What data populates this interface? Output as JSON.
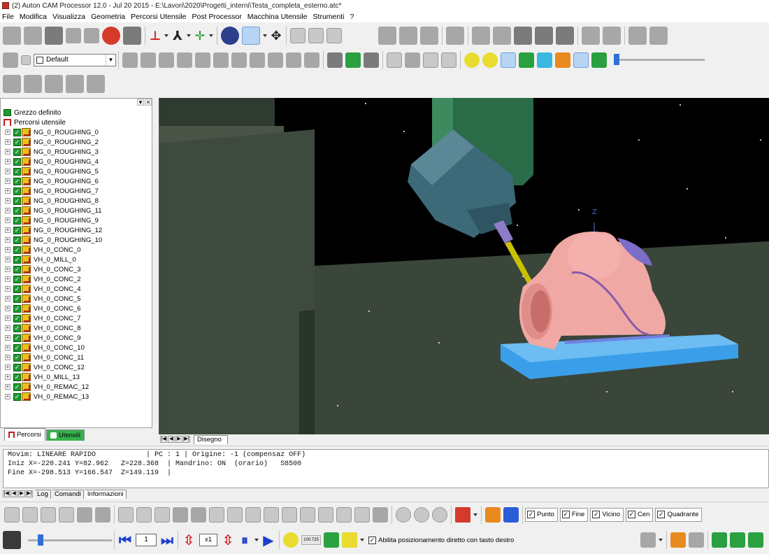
{
  "window": {
    "title": "(2) Auton CAM Processor 12.0  -  Jul 20 2015 - E:\\Lavori\\2020\\Progetti_interni\\Testa_completa_esterno.atc*"
  },
  "menu": [
    "File",
    "Modifica",
    "Visualizza",
    "Geometria",
    "Percorsi Utensile",
    "Post Processor",
    "Macchina Utensile",
    "Strumenti",
    "?"
  ],
  "layer_combo": {
    "value": "Default"
  },
  "tree": {
    "stock_label": "Grezzo definito",
    "toolpaths_label": "Percorsi utensile",
    "items": [
      "NG_0_ROUGHING_0",
      "NG_0_ROUGHING_2",
      "NG_0_ROUGHING_3",
      "NG_0_ROUGHING_4",
      "NG_0_ROUGHING_5",
      "NG_0_ROUGHING_6",
      "NG_0_ROUGHING_7",
      "NG_0_ROUGHING_8",
      "NG_0_ROUGHING_11",
      "NG_0_ROUGHING_9",
      "NG_0_ROUGHING_12",
      "NG_0_ROUGHING_10",
      "VH_0_CONC_0",
      "VH_0_MILL_0",
      "VH_0_CONC_3",
      "VH_0_CONC_2",
      "VH_0_CONC_4",
      "VH_0_CONC_5",
      "VH_0_CONC_6",
      "VH_0_CONC_7",
      "VH_0_CONC_8",
      "VH_0_CONC_9",
      "VH_0_CONC_10",
      "VH_0_CONC_11",
      "VH_0_CONC_12",
      "VH_0_MILL_13",
      "VH_0_REMAC_12",
      "VH_0_REMAC_13"
    ]
  },
  "left_tabs": {
    "paths": "Percorsi",
    "tools": "Utensili"
  },
  "viewport": {
    "axis_label": "Z",
    "tab": "Disegno"
  },
  "console": {
    "line1": "Movim: LINEARE RAPIDO            | PC : 1 | Origine: -1 (compensaz OFF)",
    "line2": "Iniz X=-220.241 Y=82.962   Z=228.368  | Mandrino: ON  (orario)   S8500",
    "line3": "Fine X=-298.513 Y=166.547  Z=149.119  |"
  },
  "console_tabs": [
    "Log",
    "Comandi",
    "Informazioni"
  ],
  "snap": [
    "Punto",
    "Fine",
    "Vicino",
    "Cen",
    "Quadrante"
  ],
  "sim": {
    "step": "1",
    "speed": "x1",
    "speed_fraction": 0.15,
    "counter": "100.725",
    "direct_label": "Abilita posizionamento diretto con tasto destro"
  },
  "colors": {
    "part": "#f0a8a4",
    "table": "#3a9ee8",
    "spindle": "#2a6b48",
    "head": "#3d6a78",
    "tool": "#c8c000",
    "machine_wall": "#3d4a3d",
    "check": "#1e9a2e"
  }
}
